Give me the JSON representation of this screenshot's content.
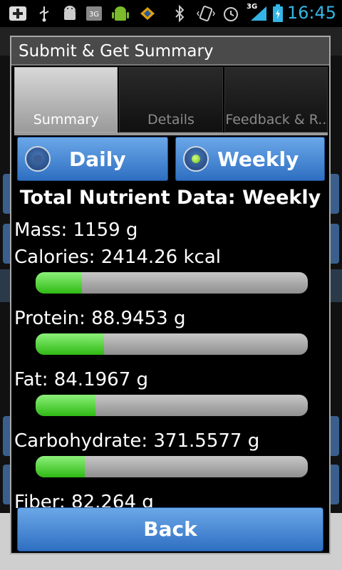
{
  "status_bar": {
    "time": "16:45",
    "network": "3G",
    "icons": [
      "plus-icon",
      "usb-icon",
      "android-icon",
      "3g-icon",
      "android-robot-icon",
      "sd-card-icon",
      "bluetooth-icon",
      "vibrate-icon",
      "alarm-icon",
      "signal-icon",
      "battery-icon"
    ]
  },
  "dialog": {
    "title": "Submit & Get Summary",
    "tabs": [
      {
        "label": "Summary",
        "active": true
      },
      {
        "label": "Details",
        "active": false
      },
      {
        "label": "Feedback & R..",
        "active": false
      }
    ],
    "period": {
      "options": [
        {
          "label": "Daily",
          "selected": false
        },
        {
          "label": "Weekly",
          "selected": true
        }
      ]
    },
    "heading": "Total Nutrient Data: Weekly",
    "mass": "Mass: 1159 g",
    "nutrients": [
      {
        "label": "Calories: 2414.26 kcal",
        "progress": 0.17
      },
      {
        "label": "Protein: 88.9453 g",
        "progress": 0.25
      },
      {
        "label": "Fat: 84.1967 g",
        "progress": 0.22
      },
      {
        "label": "Carbohydrate: 371.5577 g",
        "progress": 0.18
      }
    ],
    "fiber_partial": "Fiber: 82.264 g",
    "back_label": "Back"
  },
  "colors": {
    "button_blue": "#3d7fd0",
    "progress_green": "#2fba14",
    "clock_blue": "#33b5e5"
  }
}
